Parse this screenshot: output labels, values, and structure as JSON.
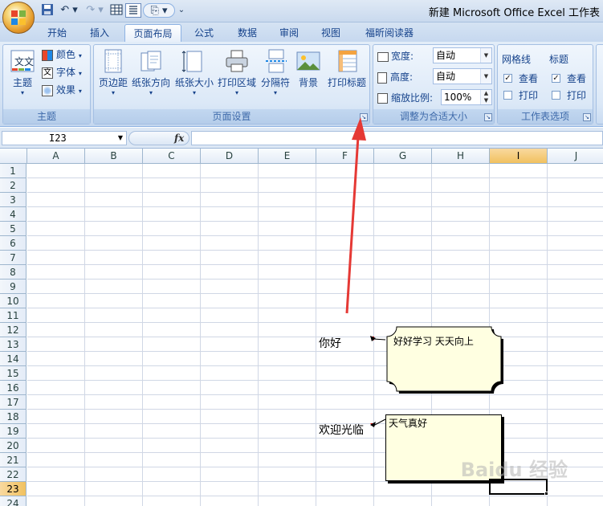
{
  "window": {
    "title": "新建 Microsoft Office Excel 工作表"
  },
  "tabs": [
    {
      "label": "开始"
    },
    {
      "label": "插入"
    },
    {
      "label": "页面布局",
      "active": true
    },
    {
      "label": "公式"
    },
    {
      "label": "数据"
    },
    {
      "label": "审阅"
    },
    {
      "label": "视图"
    },
    {
      "label": "福昕阅读器"
    }
  ],
  "ribbon": {
    "themes": {
      "label": "主题",
      "themes_button": "主题",
      "colors": "颜色",
      "fonts": "字体",
      "effects": "效果"
    },
    "page_setup": {
      "label": "页面设置",
      "margins": "页边距",
      "orientation": "纸张方向",
      "size": "纸张大小",
      "print_area": "打印区域",
      "breaks": "分隔符",
      "background": "背景",
      "print_titles": "打印标题"
    },
    "scale_to_fit": {
      "label": "调整为合适大小",
      "width_label": "宽度:",
      "width_value": "自动",
      "height_label": "高度:",
      "height_value": "自动",
      "scale_label": "缩放比例:",
      "scale_value": "100%"
    },
    "sheet_options": {
      "label": "工作表选项",
      "gridlines": "网格线",
      "headings": "标题",
      "view": "查看",
      "print": "打印",
      "gridlines_view": true,
      "gridlines_print": false,
      "headings_view": true,
      "headings_print": false
    }
  },
  "formula_bar": {
    "name_box": "I23",
    "fx": "fx",
    "formula": ""
  },
  "sheet": {
    "columns": [
      "A",
      "B",
      "C",
      "D",
      "E",
      "F",
      "G",
      "H",
      "I",
      "J"
    ],
    "rows": [
      "1",
      "2",
      "3",
      "4",
      "5",
      "6",
      "7",
      "8",
      "9",
      "10",
      "11",
      "12",
      "13",
      "14",
      "15",
      "16",
      "17",
      "18",
      "19",
      "20",
      "21",
      "22",
      "23",
      "24"
    ],
    "selected_column": "I",
    "selected_row": "23",
    "cells": {
      "F13": "你好",
      "F19": "欢迎光临"
    },
    "comments": [
      {
        "cell": "F13",
        "text": "好好学习 天天向上"
      },
      {
        "cell": "F19",
        "text": "天气真好"
      }
    ]
  },
  "watermark": "Baidu 经验",
  "colors": {
    "arrow": "#e53935",
    "comment_fill": "#ffffe1",
    "selected_header": "#f1c15f"
  }
}
